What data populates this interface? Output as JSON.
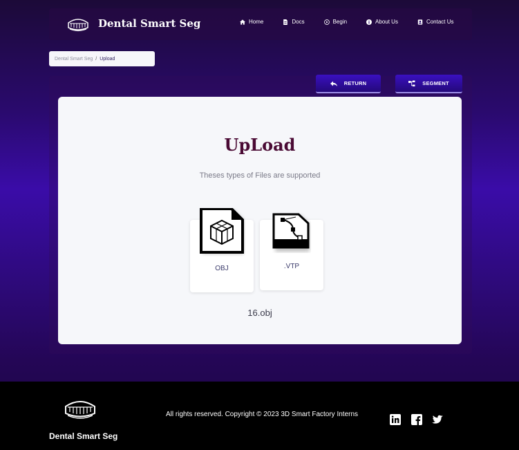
{
  "header": {
    "brand": "Dental Smart Seg",
    "nav": [
      {
        "label": "Home",
        "icon": "home-icon"
      },
      {
        "label": "Docs",
        "icon": "document-icon"
      },
      {
        "label": "Begin",
        "icon": "play-circle-icon"
      },
      {
        "label": "About Us",
        "icon": "info-circle-icon"
      },
      {
        "label": "Contact Us",
        "icon": "contact-card-icon"
      }
    ]
  },
  "breadcrumb": {
    "root": "Dental Smart Seg",
    "separator": "/",
    "current": "Upload"
  },
  "actions": {
    "return_label": "RETURN",
    "segment_label": "SEGMENT"
  },
  "upload": {
    "title": "UpLoad",
    "subtitle": "Theses types of Files are supported",
    "file_types": [
      {
        "label": "OBJ",
        "icon": "obj-file-icon"
      },
      {
        "label": ".VTP",
        "icon": "vtp-file-icon"
      }
    ],
    "filename": "16.obj"
  },
  "footer": {
    "brand": "Dental Smart Seg",
    "copyright": "All rights reserved. Copyright © 2023 3D Smart Factory Interns",
    "social": [
      "linkedin-icon",
      "facebook-icon",
      "twitter-icon"
    ]
  },
  "colors": {
    "accent": "#2e0a9e",
    "title": "#4a0a34",
    "footer_bg": "#000000"
  }
}
